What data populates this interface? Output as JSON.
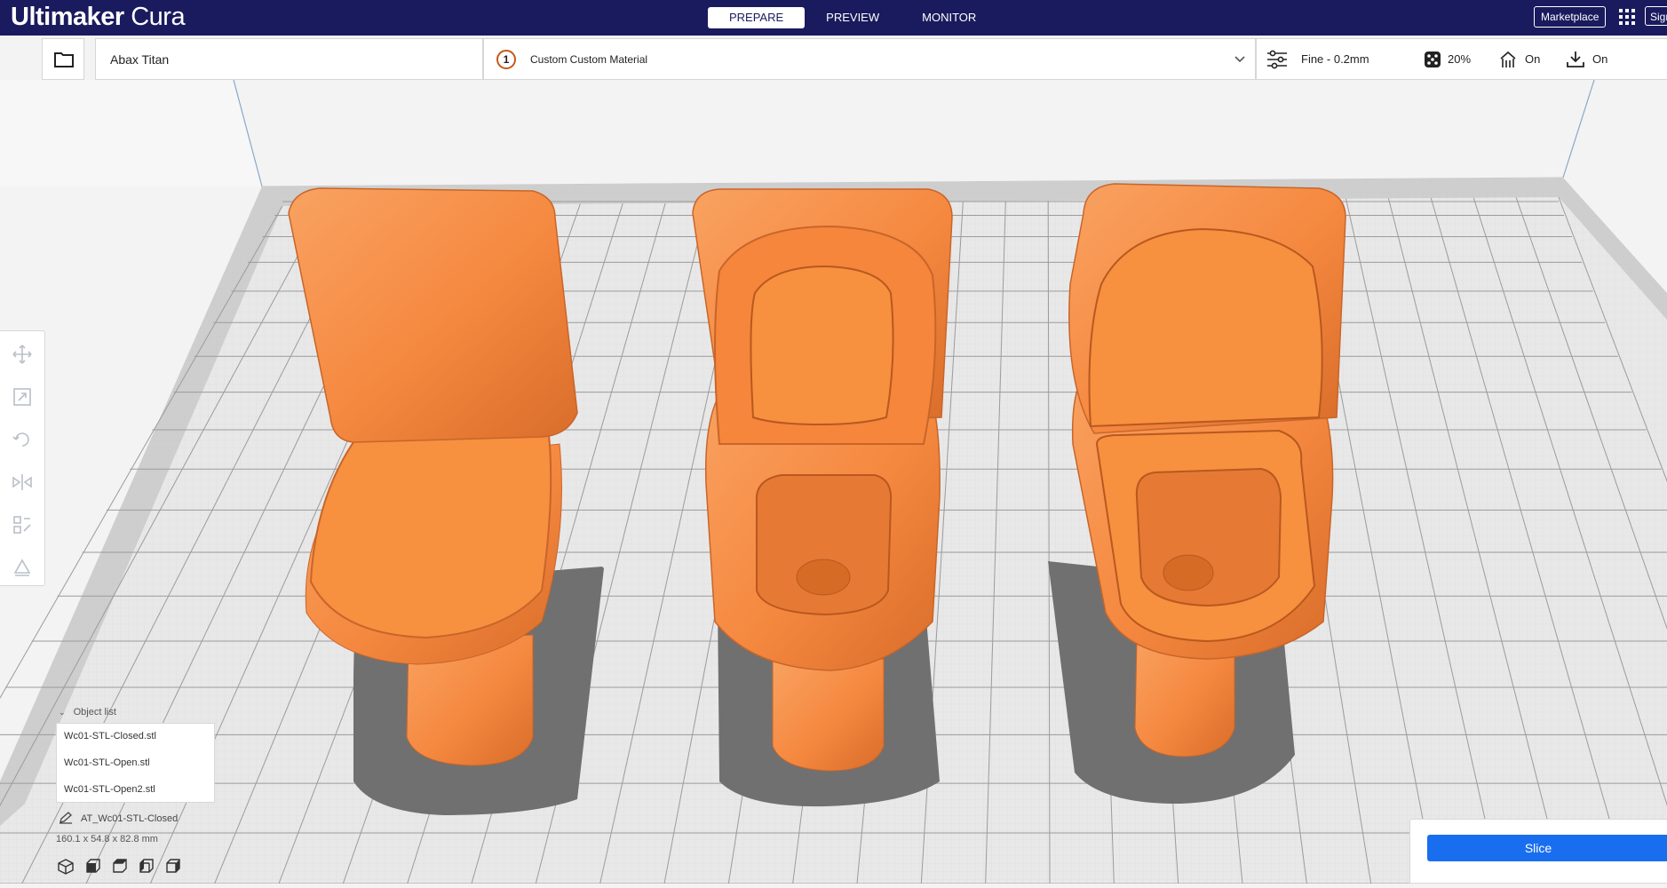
{
  "app": {
    "brand_bold": "Ultimaker",
    "brand_light": "Cura"
  },
  "stages": [
    {
      "label": "PREPARE",
      "active": true
    },
    {
      "label": "PREVIEW",
      "active": false
    },
    {
      "label": "MONITOR",
      "active": false
    }
  ],
  "header": {
    "marketplace_label": "Marketplace",
    "signin_label": "Sign in"
  },
  "toolbar": {
    "printer": "Abax Titan",
    "extruder_number": "1",
    "material": "Custom Custom Material",
    "profile": "Fine - 0.2mm",
    "infill": "20%",
    "support": "On",
    "adhesion": "On"
  },
  "object_list": {
    "title": "Object list",
    "items": [
      "Wc01-STL-Closed.stl",
      "Wc01-STL-Open.stl",
      "Wc01-STL-Open2.stl"
    ],
    "selected_name": "AT_Wc01-STL-Closed",
    "dimensions": "160.1 x 54.8 x 82.8 mm"
  },
  "slice": {
    "label": "Slice"
  },
  "colors": {
    "header": "#1a1a5e",
    "model": "#f78c47",
    "accent": "#196ef0"
  },
  "icons": [
    "folder-icon",
    "chevron-down-icon",
    "sliders-icon",
    "infill-icon",
    "support-icon",
    "adhesion-icon",
    "move-icon",
    "scale-icon",
    "rotate-icon",
    "mirror-icon",
    "per-model-settings-icon",
    "support-blocker-icon",
    "pencil-icon",
    "view-3d-icon",
    "view-front-icon",
    "view-top-icon",
    "view-left-icon",
    "view-right-icon",
    "apps-grid-icon"
  ]
}
